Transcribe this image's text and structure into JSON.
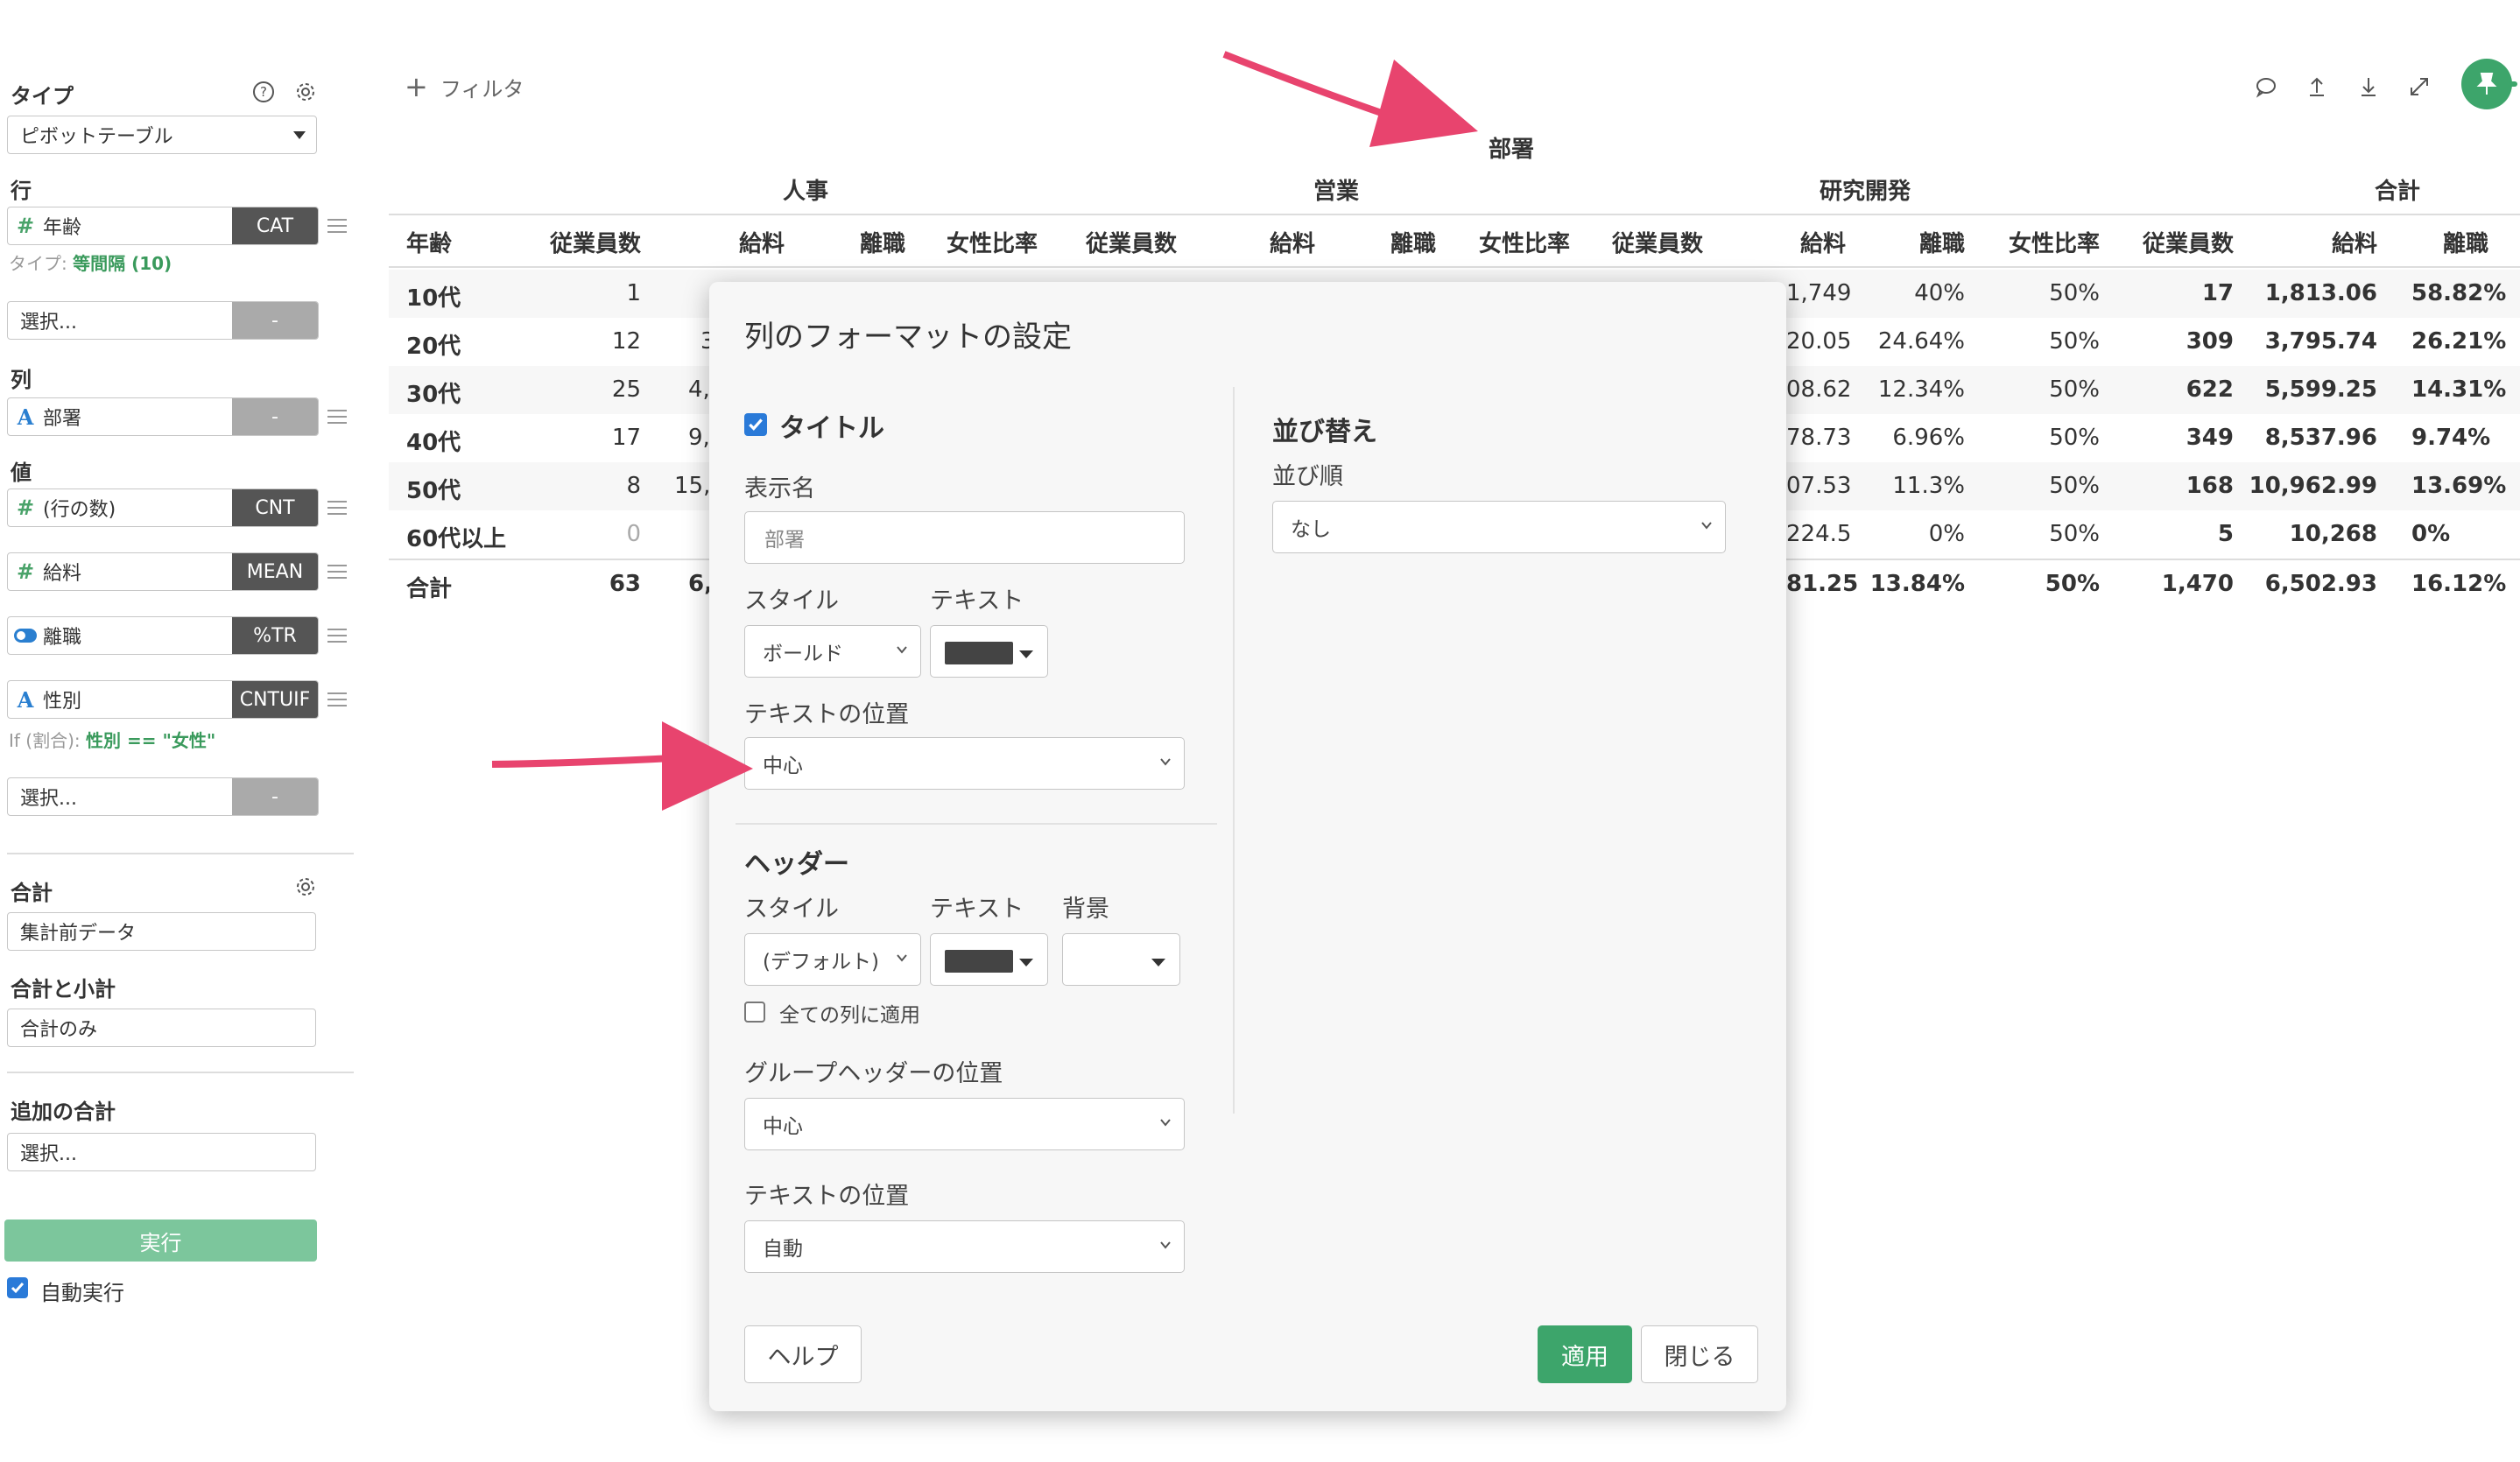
{
  "left_panel": {
    "type_title": "タイプ",
    "type_value": "ピボットテーブル",
    "row_title": "行",
    "row_field": {
      "icon": "#",
      "label": "年齢",
      "tag": "CAT"
    },
    "row_hint_prefix": "タイプ:",
    "row_hint_value": "等間隔 (10)",
    "row_select": {
      "label": "選択...",
      "tag": "-"
    },
    "col_title": "列",
    "col_field": {
      "icon": "A",
      "label": "部署",
      "tag": "-"
    },
    "val_title": "値",
    "values": [
      {
        "icon": "#",
        "label": "(行の数)",
        "tag": "CNT"
      },
      {
        "icon": "#",
        "label": "給料",
        "tag": "MEAN"
      },
      {
        "icon": "toggle",
        "label": "離職",
        "tag": "%TR"
      },
      {
        "icon": "A",
        "label": "性別",
        "tag": "CNTUIF"
      }
    ],
    "val_hint_prefix": "If (割合):",
    "val_hint_value": "性別 == \"女性\"",
    "val_select": {
      "label": "選択...",
      "tag": "-"
    },
    "total_title": "合計",
    "total_value": "集計前データ",
    "subtotal_title": "合計と小計",
    "subtotal_value": "合計のみ",
    "extra_title": "追加の合計",
    "extra_value": "選択...",
    "run_label": "実行",
    "auto_run_label": "自動実行",
    "auto_run_checked": true
  },
  "toolbar": {
    "add_filter_label": "フィルタ",
    "icons": [
      "comment-icon",
      "upload-icon",
      "download-icon",
      "expand-icon",
      "pin-icon"
    ]
  },
  "table": {
    "title": "部署",
    "groups": [
      "人事",
      "営業",
      "研究開発",
      "合計"
    ],
    "row_header": "年齢",
    "col_headers": [
      "従業員数",
      "給料",
      "離職",
      "女性比率",
      "従業員数",
      "給料",
      "離職",
      "女性比率",
      "従業員数",
      "給料",
      "離職",
      "女性比率",
      "従業員数",
      "給料",
      "離職"
    ],
    "rows": [
      {
        "label": "10代",
        "hr_count": "1",
        "rd_salary": "1,749",
        "rd_attr": "40%",
        "rd_female": "50%",
        "t_count": "17",
        "t_salary": "1,813.06",
        "t_attr": "58.82%"
      },
      {
        "label": "20代",
        "hr_count": "12",
        "hr_salary_part": "3",
        "rd_salary": "20.05",
        "rd_attr": "24.64%",
        "rd_female": "50%",
        "t_count": "309",
        "t_salary": "3,795.74",
        "t_attr": "26.21%"
      },
      {
        "label": "30代",
        "hr_count": "25",
        "hr_salary_part": "4,",
        "rd_salary": "08.62",
        "rd_attr": "12.34%",
        "rd_female": "50%",
        "t_count": "622",
        "t_salary": "5,599.25",
        "t_attr": "14.31%"
      },
      {
        "label": "40代",
        "hr_count": "17",
        "hr_salary_part": "9,",
        "rd_salary": "78.73",
        "rd_attr": "6.96%",
        "rd_female": "50%",
        "t_count": "349",
        "t_salary": "8,537.96",
        "t_attr": "9.74%"
      },
      {
        "label": "50代",
        "hr_count": "8",
        "hr_salary_part": "15,",
        "rd_salary": "07.53",
        "rd_attr": "11.3%",
        "rd_female": "50%",
        "t_count": "168",
        "t_salary": "10,962.99",
        "t_attr": "13.69%"
      },
      {
        "label": "60代以上",
        "hr_count": "0",
        "rd_salary": "224.5",
        "rd_attr": "0%",
        "rd_female": "50%",
        "t_count": "5",
        "t_salary": "10,268",
        "t_attr": "0%"
      }
    ],
    "total_row": {
      "label": "合計",
      "hr_count": "63",
      "hr_salary_part": "6,",
      "rd_salary": "81.25",
      "rd_attr": "13.84%",
      "rd_female": "50%",
      "t_count": "1,470",
      "t_salary": "6,502.93",
      "t_attr": "16.12%"
    }
  },
  "dialog": {
    "title": "列のフォーマットの設定",
    "title_section": {
      "checkbox_label": "タイトル",
      "checked": true,
      "display_name_label": "表示名",
      "display_name_value": "部署",
      "style_label": "スタイル",
      "style_value": "ボールド",
      "text_label": "テキスト",
      "text_color": "#444444",
      "position_label": "テキストの位置",
      "position_value": "中心"
    },
    "header_section": {
      "heading": "ヘッダー",
      "style_label": "スタイル",
      "style_value": "(デフォルト)",
      "text_label": "テキスト",
      "text_color": "#444444",
      "bg_label": "背景",
      "apply_all_label": "全ての列に適用",
      "apply_all_checked": false,
      "group_pos_label": "グループヘッダーの位置",
      "group_pos_value": "中心",
      "text_pos_label": "テキストの位置",
      "text_pos_value": "自動"
    },
    "sort_section": {
      "heading": "並び替え",
      "order_label": "並び順",
      "order_value": "なし"
    },
    "help_button": "ヘルプ",
    "apply_button": "適用",
    "close_button": "閉じる"
  },
  "colors": {
    "accent_green": "#3da56b",
    "arrow_pink": "#e8446e",
    "checkbox_blue": "#2a7ad8"
  }
}
